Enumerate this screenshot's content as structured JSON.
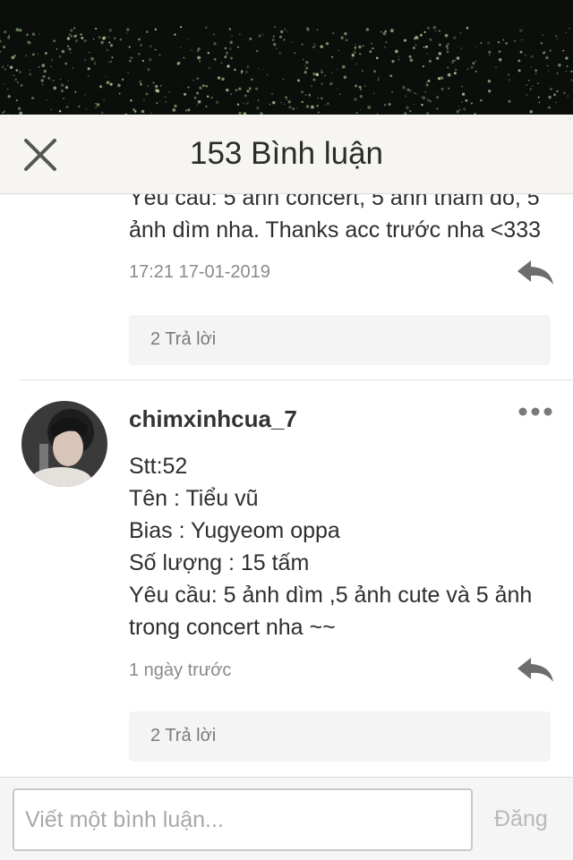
{
  "header": {
    "title": "153 Bình luận",
    "close_icon": "close-icon"
  },
  "comments": [
    {
      "body": "Yêu cầu: 5 ảnh concert, 5 ảnh thăm dò, 5\nảnh dìm nha. Thanks acc trước nha <333",
      "time": "17:21 17-01-2019",
      "replies_label": "2 Trả lời",
      "reply_icon": "reply-arrow-icon"
    },
    {
      "username": "chimxinhcua_7",
      "more_icon": "more-dots-icon",
      "avatar_icon": "user-avatar",
      "body": "Stt:52\nTên : Tiểu vũ\nBias : Yugyeom oppa\n Số lượng : 15 tấm\nYêu cầu: 5 ảnh dìm ,5 ảnh cute và 5 ảnh\ntrong concert nha ~~",
      "time": "1 ngày trước",
      "replies_label": "2 Trả lời",
      "reply_icon": "reply-arrow-icon"
    }
  ],
  "composer": {
    "placeholder": "Viết một bình luận...",
    "value": "",
    "post_label": "Đăng"
  },
  "colors": {
    "header_bg": "#f6f5f1",
    "reply_icon": "#6d6d6d",
    "replies_bg": "#f4f4f4",
    "post_disabled": "#b9b9b9"
  }
}
